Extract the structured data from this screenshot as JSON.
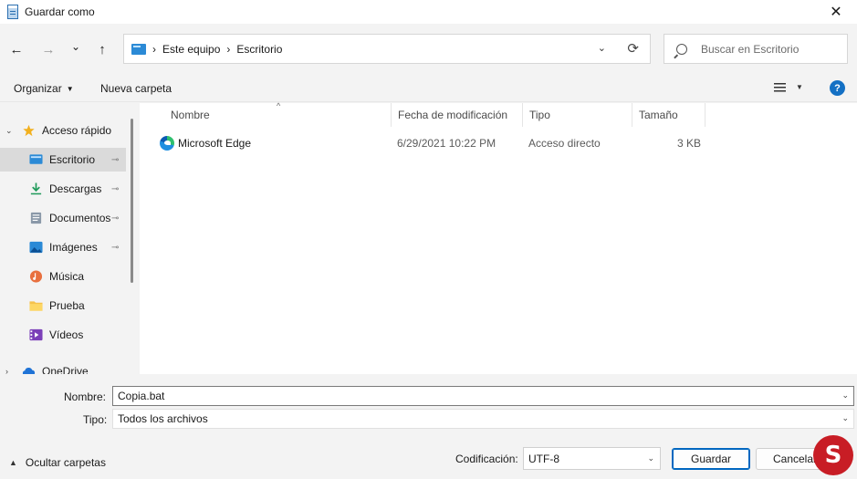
{
  "window": {
    "title": "Guardar como",
    "close_glyph": "✕"
  },
  "nav": {
    "back_glyph": "←",
    "forward_glyph": "→",
    "recent_glyph": "⌄",
    "up_glyph": "↑",
    "breadcrumbs": [
      "Este equipo",
      "Escritorio"
    ],
    "breadcrumb_sep": "›",
    "address_dropdown_glyph": "⌄",
    "refresh_glyph": "⟳",
    "search_placeholder": "Buscar en Escritorio"
  },
  "commandbar": {
    "organize_label": "Organizar",
    "new_folder_label": "Nueva carpeta",
    "help_label": "?"
  },
  "sidebar": {
    "items": [
      {
        "label": "Acceso rápido",
        "icon": "star-icon",
        "pinned": false,
        "expander": "⌄"
      },
      {
        "label": "Escritorio",
        "icon": "desktop-icon",
        "pinned": true
      },
      {
        "label": "Descargas",
        "icon": "download-icon",
        "pinned": true
      },
      {
        "label": "Documentos",
        "icon": "document-icon",
        "pinned": true
      },
      {
        "label": "Imágenes",
        "icon": "pictures-icon",
        "pinned": true
      },
      {
        "label": "Música",
        "icon": "music-icon",
        "pinned": false
      },
      {
        "label": "Prueba",
        "icon": "folder-icon",
        "pinned": false
      },
      {
        "label": "Vídeos",
        "icon": "videos-icon",
        "pinned": false
      },
      {
        "label": "OneDrive",
        "icon": "cloud-icon",
        "pinned": false,
        "expander": "›"
      }
    ],
    "pin_glyph": "📌"
  },
  "list": {
    "columns": [
      "Nombre",
      "Fecha de modificación",
      "Tipo",
      "Tamaño"
    ],
    "sort_glyph": "^",
    "rows": [
      {
        "name": "Microsoft Edge",
        "modified": "6/29/2021 10:22 PM",
        "type": "Acceso directo",
        "size": "3 KB",
        "icon": "edge-icon"
      }
    ]
  },
  "save": {
    "filename_label": "Nombre:",
    "filename_value": "Copia.bat",
    "type_label": "Tipo:",
    "type_value": "Todos los archivos",
    "hide_folders_label": "Ocultar carpetas",
    "encoding_label": "Codificación:",
    "encoding_value": "UTF-8",
    "save_button": "Guardar",
    "cancel_button": "Cancelar",
    "dropdown_glyph": "⌄",
    "watermark_letter": "S"
  },
  "colors": {
    "accent": "#0067c0",
    "selected_bg": "#dadada",
    "watermark": "#c81d25"
  }
}
